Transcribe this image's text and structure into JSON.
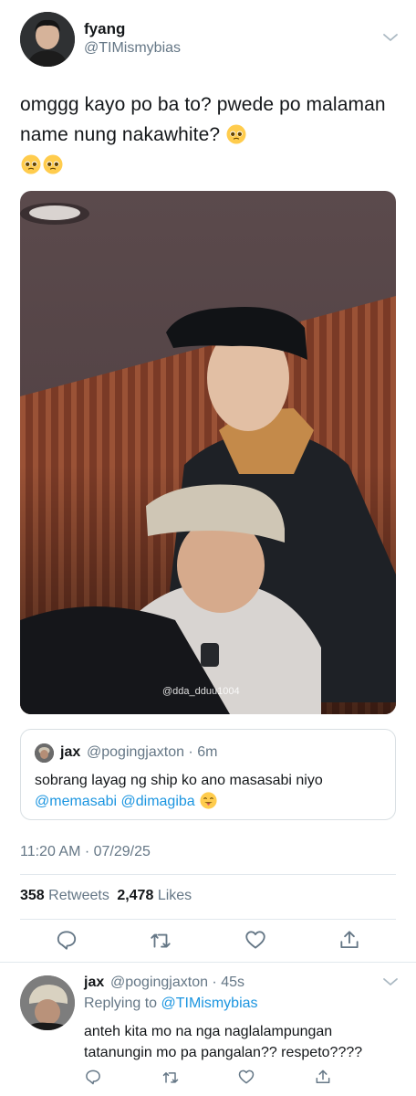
{
  "tweet": {
    "display_name": "fyang",
    "handle": "@TIMismybias",
    "text": "omggg kayo po ba to? pwede po malaman name nung nakawhite? ",
    "emoji_name": "pleading-face",
    "photo_watermark": "@dda_dduu1004",
    "timestamp": "11:20 AM · 07/29/25",
    "retweets_count": "358",
    "retweets_label": "Retweets",
    "likes_count": "2,478",
    "likes_label": "Likes"
  },
  "quote": {
    "display_name": "jax",
    "handle_time": "@pogingjaxton · 6m",
    "text": "sobrang layag ng ship ko ano masasabi niyo",
    "mention_1": "@memasabi",
    "mention_2": "@dimagiba",
    "emoji_name": "tongue-face"
  },
  "actions": [
    "reply-icon",
    "retweet-icon",
    "like-icon",
    "share-icon"
  ],
  "reply": {
    "display_name": "jax",
    "handle_time": "@pogingjaxton · 45s",
    "replying_label": "Replying to",
    "replying_to": "@TIMismybias",
    "text": "anteh kita mo na nga naglalampungan tatanungin mo pa pangalan?? respeto????"
  },
  "colors": {
    "text": "#14171a",
    "secondary": "#657786",
    "link": "#1b95e0",
    "divider": "#e1e8ed"
  }
}
